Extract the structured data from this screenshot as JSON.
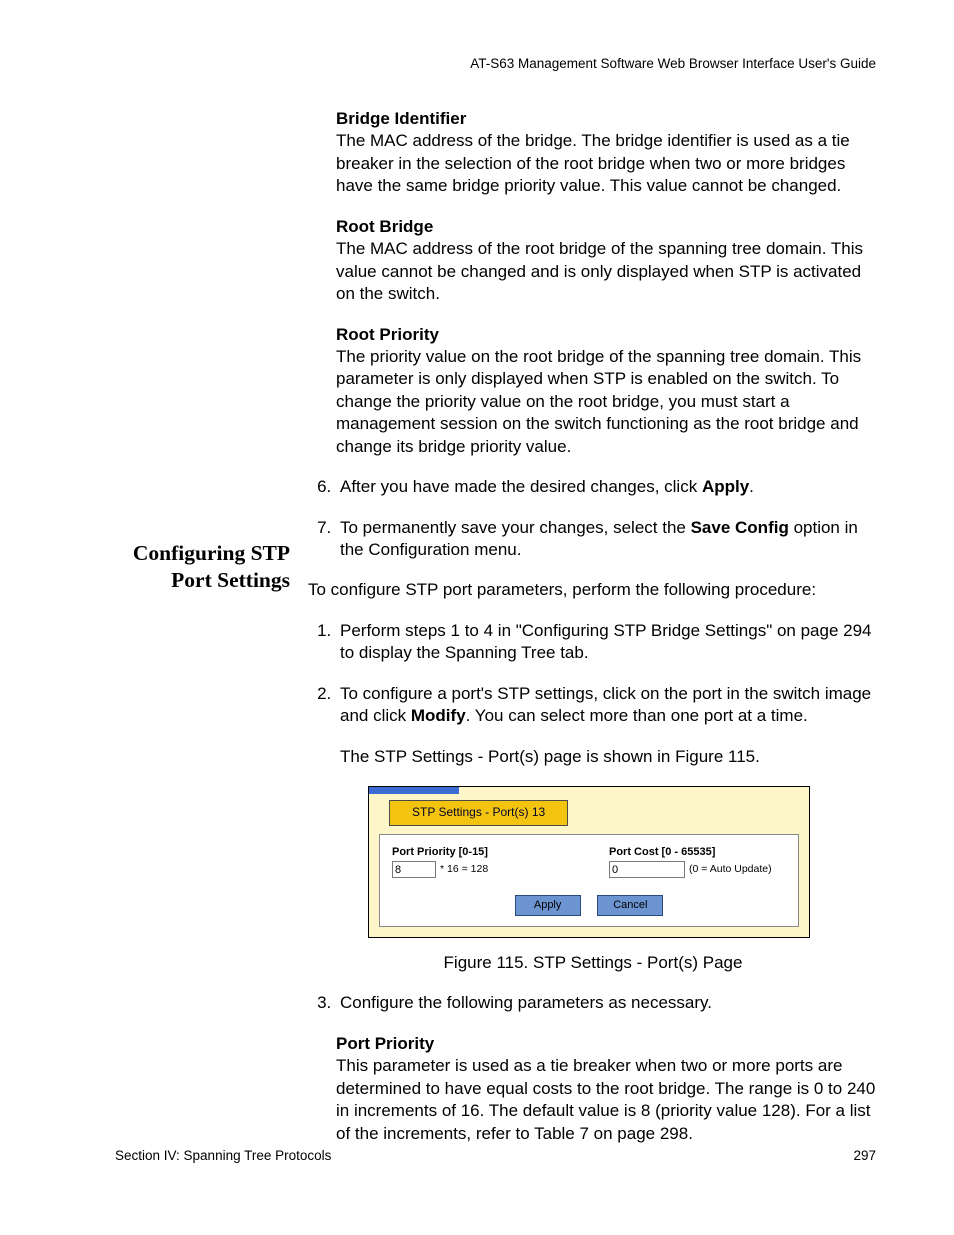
{
  "header": {
    "guide_title": "AT-S63 Management Software Web Browser Interface User's Guide"
  },
  "defs": {
    "bridge_identifier": {
      "title": "Bridge Identifier",
      "body": "The MAC address of the bridge. The bridge identifier is used as a tie breaker in the selection of the root bridge when two or more bridges have the same bridge priority value. This value cannot be changed."
    },
    "root_bridge": {
      "title": "Root Bridge",
      "body": "The MAC address of the root bridge of the spanning tree domain. This value cannot be changed and is only displayed when STP is activated on the switch."
    },
    "root_priority": {
      "title": "Root Priority",
      "body": "The priority value on the root bridge of the spanning tree domain. This parameter is only displayed when STP is enabled on the switch. To change the priority value on the root bridge, you must start a management session on the switch functioning as the root bridge and change its bridge priority value."
    },
    "port_priority": {
      "title": "Port Priority",
      "body": "This parameter is used as a tie breaker when two or more ports are determined to have equal costs to the root bridge. The range is 0 to 240 in increments of 16. The default value is 8 (priority value 128). For a list of the increments, refer to Table 7 on page 298."
    }
  },
  "steps_upper": {
    "six_a": "After you have made the desired changes, click ",
    "six_b": "Apply",
    "six_c": ".",
    "seven_a": "To permanently save your changes, select the ",
    "seven_b": "Save Config",
    "seven_c": " option in the Configuration menu."
  },
  "section": {
    "title": "Configuring STP Port Settings"
  },
  "intro": {
    "text": "To configure STP port parameters, perform the following procedure:"
  },
  "steps_lower": {
    "one": "Perform steps 1 to 4 in \"Configuring STP Bridge Settings\" on page 294 to display the Spanning Tree tab.",
    "two_a": "To configure a port's STP settings, click on the port in the switch image and click ",
    "two_b": "Modify",
    "two_c": ". You can select more than one port at a time.",
    "two_after": "The STP Settings - Port(s) page is shown in Figure 115.",
    "three": "Configure the following parameters as necessary."
  },
  "figure": {
    "tab": "STP Settings - Port(s) 13",
    "pp_label": "Port Priority [0-15]",
    "pp_value": "8",
    "pp_suffix": "* 16 = 128",
    "pc_label": "Port Cost [0 - 65535]",
    "pc_value": "0",
    "pc_suffix": "(0 = Auto Update)",
    "apply": "Apply",
    "cancel": "Cancel",
    "caption": "Figure 115. STP Settings - Port(s) Page"
  },
  "footer": {
    "section": "Section IV: Spanning Tree Protocols",
    "page": "297"
  }
}
